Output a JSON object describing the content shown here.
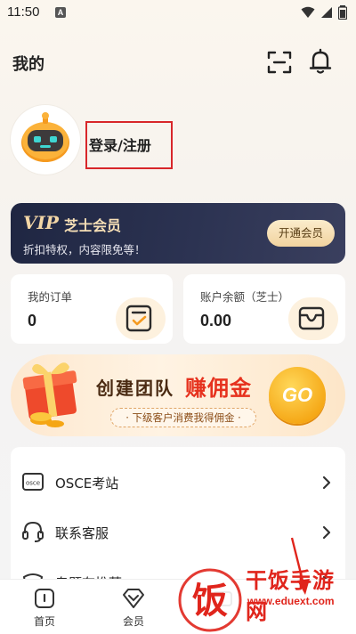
{
  "status_bar": {
    "time": "11:50",
    "a_badge": "A"
  },
  "header": {
    "title": "我的"
  },
  "profile": {
    "login_text": "登录/注册"
  },
  "vip": {
    "logo": "VIP",
    "title": "芝士会员",
    "subtitle": "折扣特权，内容限免等！",
    "button": "开通会员"
  },
  "stats": [
    {
      "label": "我的订单",
      "value": "0"
    },
    {
      "label": "账户余额（芝士）",
      "value": "0.00"
    }
  ],
  "banner": {
    "title_a": "创建团队",
    "title_b": "赚佣金",
    "pill": "· 下级客户消费我得佣金 ·",
    "go": "GO"
  },
  "menu": [
    {
      "label": "OSCE考站",
      "icon": "osce-icon"
    },
    {
      "label": "联系客服",
      "icon": "headset-icon"
    },
    {
      "label": "专题有推荐",
      "icon": "recommend-icon"
    }
  ],
  "bottom_nav": [
    {
      "label": "首页",
      "icon": "home-icon"
    },
    {
      "label": "会员",
      "icon": "diamond-icon"
    }
  ],
  "watermark": {
    "main": "干饭手游网",
    "url": "www.eduext.com"
  },
  "colors": {
    "vip_bg": "#1f2642",
    "accent_red": "#e0251c",
    "gold": "#f5a614"
  }
}
